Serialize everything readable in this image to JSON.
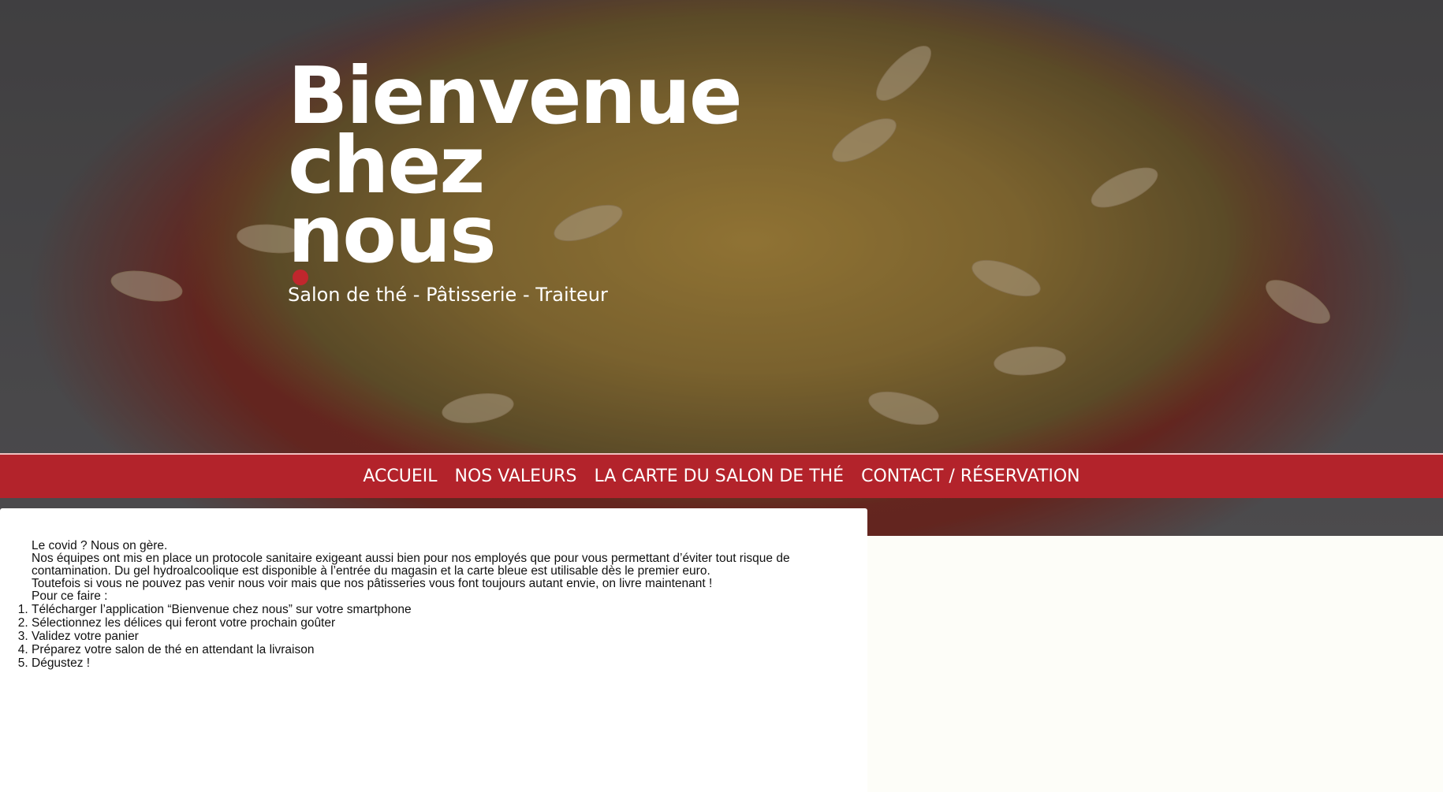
{
  "hero": {
    "title_line1": "Bienvenue",
    "title_line2": "chez",
    "title_line3": "nous",
    "subtitle": "Salon de thé - Pâtisserie - Traiteur",
    "accent_color": "#c0272d"
  },
  "nav": {
    "items": [
      {
        "label": "ACCUEIL"
      },
      {
        "label": "NOS VALEURS"
      },
      {
        "label": "LA CARTE DU SALON DE THÉ"
      },
      {
        "label": "CONTACT / RÉSERVATION"
      }
    ],
    "background_color": "#b3232b"
  },
  "content": {
    "line1": "Le covid ? Nous on gère.",
    "line2": "Nos équipes ont mis en place un protocole sanitaire exigeant aussi bien pour nos employés que pour vous permettant d’éviter tout risque de contamination. Du gel hydroalcoolique est disponible à l’entrée du magasin et la carte bleue est utilisable dès le premier euro.",
    "line3": "Toutefois si vous ne pouvez pas venir nous voir mais que nos pâtisseries vous font toujours autant envie, on livre maintenant !",
    "line4": "Pour ce faire :",
    "steps": [
      "Télécharger l’application “Bienvenue chez nous” sur votre smartphone",
      "Sélectionnez les délices qui feront votre prochain goûter",
      "Validez votre panier",
      "Préparez votre salon de thé en attendant la livraison",
      "Dégustez !"
    ]
  }
}
